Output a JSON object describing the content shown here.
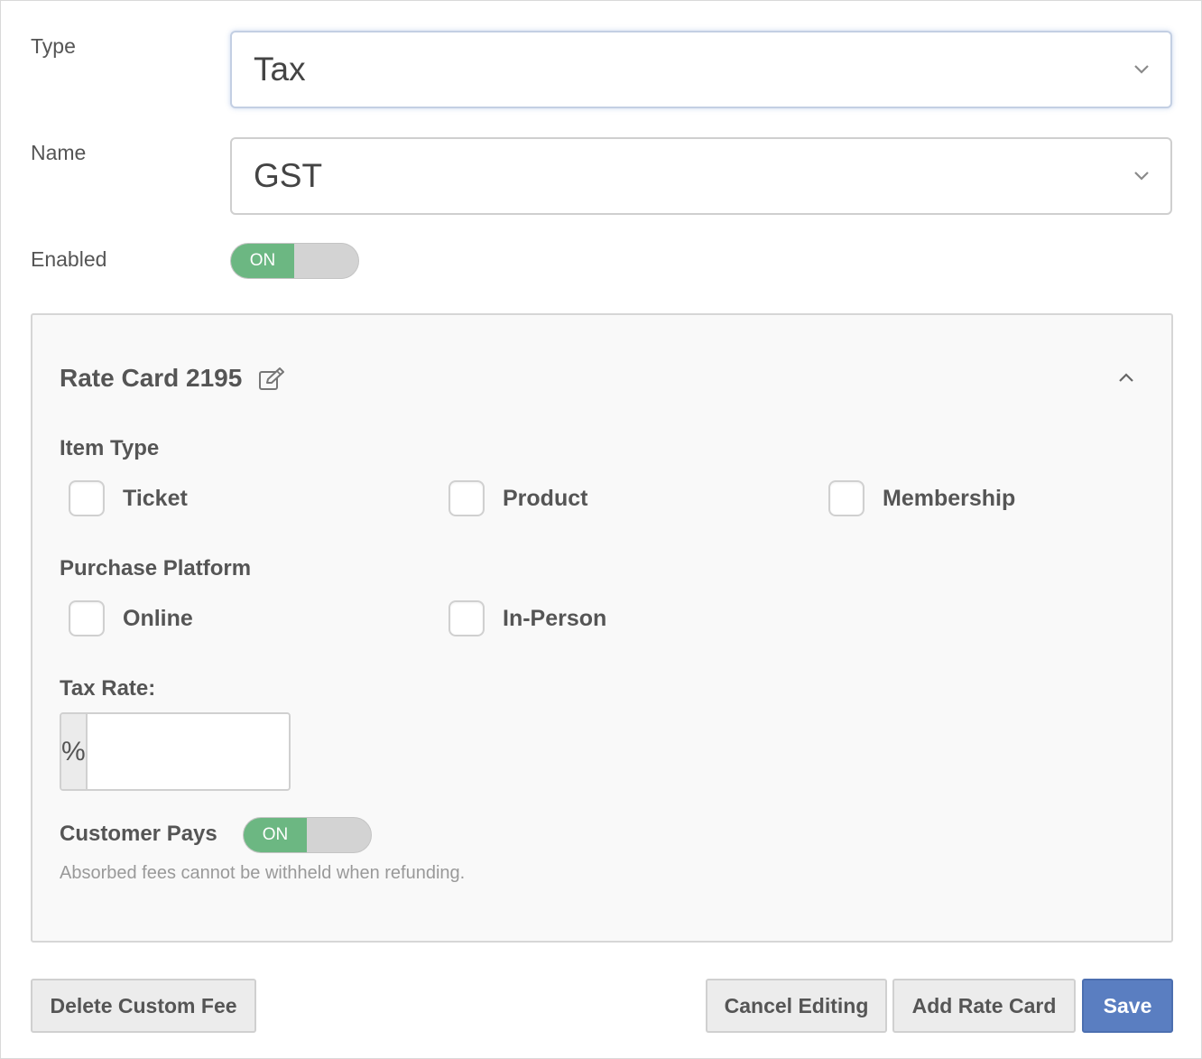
{
  "form": {
    "type": {
      "label": "Type",
      "value": "Tax"
    },
    "name": {
      "label": "Name",
      "value": "GST"
    },
    "enabled": {
      "label": "Enabled",
      "state": "ON"
    }
  },
  "rate_card": {
    "title": "Rate Card 2195",
    "item_type": {
      "label": "Item Type",
      "options": [
        "Ticket",
        "Product",
        "Membership"
      ]
    },
    "purchase_platform": {
      "label": "Purchase Platform",
      "options": [
        "Online",
        "In-Person"
      ]
    },
    "tax_rate": {
      "label": "Tax Rate:",
      "addon": "%",
      "value": ""
    },
    "customer_pays": {
      "label": "Customer Pays",
      "state": "ON",
      "help": "Absorbed fees cannot be withheld when refunding."
    }
  },
  "actions": {
    "delete": "Delete Custom Fee",
    "cancel": "Cancel Editing",
    "add_rate_card": "Add Rate Card",
    "save": "Save"
  },
  "colors": {
    "toggle_on": "#6cb782",
    "primary": "#5a7ec1"
  },
  "icons": {
    "select_arrow": "chevron-down-icon",
    "edit": "edit-icon",
    "collapse": "chevron-up-icon"
  }
}
